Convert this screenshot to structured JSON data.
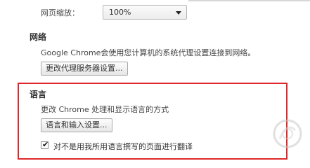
{
  "zoom": {
    "label": "网页缩放：",
    "value": "100%"
  },
  "network": {
    "title": "网络",
    "description": "Google Chrome会使用您计算机的系统代理设置连接到网络。",
    "button": "更改代理服务器设置..."
  },
  "language": {
    "title": "语言",
    "description": "更改 Chrome 处理和显示语言的方式",
    "button": "语言和输入设置...",
    "translate_checkbox": {
      "label": "对不是用我所用语言撰写的页面进行翻译",
      "checked": true
    }
  },
  "colors": {
    "highlight": "#e0282a"
  },
  "icons": {
    "dropdown": "chevron-down-icon",
    "check": "checkmark-icon",
    "watermark": "site-watermark-logo"
  }
}
